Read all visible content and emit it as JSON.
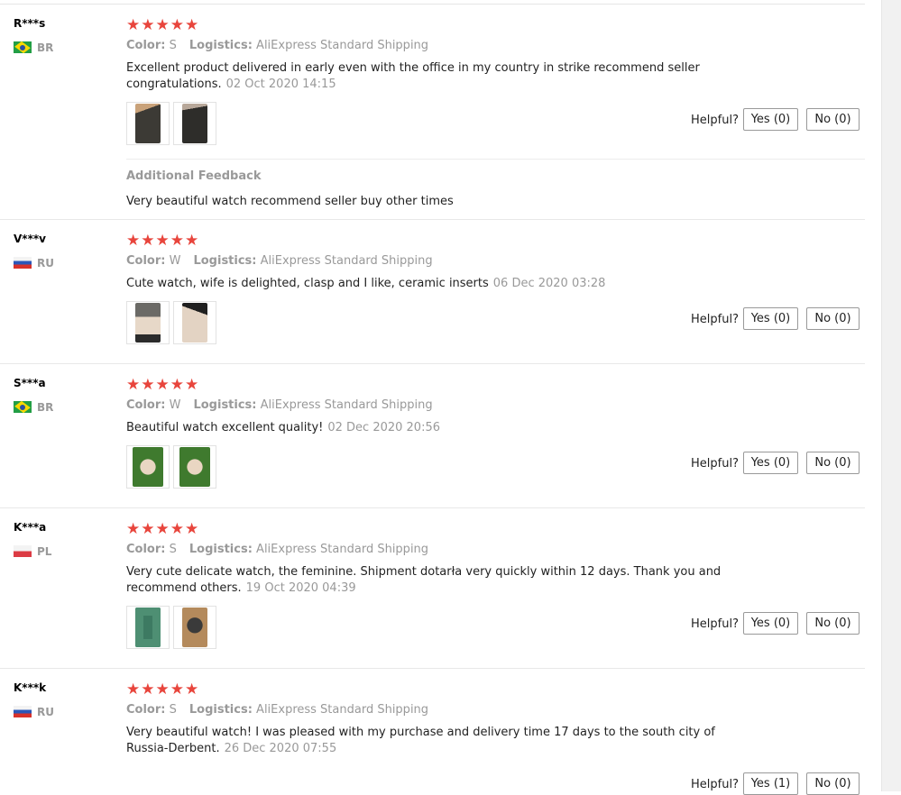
{
  "labels": {
    "color": "Color:",
    "logistics": "Logistics:",
    "helpful": "Helpful?",
    "additional_feedback": "Additional Feedback"
  },
  "rating_stars": "★★★★★",
  "reviews": [
    {
      "user": "R***s",
      "country": "BR",
      "stars": 5,
      "color": "S",
      "logistics": "AliExpress Standard Shipping",
      "text": "Excellent product delivered in early even with the office in my country in strike recommend seller congratulations.",
      "date": "02 Oct 2020 14:15",
      "yes": "Yes (0)",
      "no": "No (0)",
      "additional_feedback": "Very beautiful watch recommend seller buy other times"
    },
    {
      "user": "V***v",
      "country": "RU",
      "stars": 5,
      "color": "W",
      "logistics": "AliExpress Standard Shipping",
      "text": "Cute watch, wife is delighted, clasp and I like, ceramic inserts",
      "date": "06 Dec 2020 03:28",
      "yes": "Yes (0)",
      "no": "No (0)"
    },
    {
      "user": "S***a",
      "country": "BR",
      "stars": 5,
      "color": "W",
      "logistics": "AliExpress Standard Shipping",
      "text": "Beautiful watch excellent quality!",
      "date": "02 Dec 2020 20:56",
      "yes": "Yes (0)",
      "no": "No (0)"
    },
    {
      "user": "K***a",
      "country": "PL",
      "stars": 5,
      "color": "S",
      "logistics": "AliExpress Standard Shipping",
      "text": "Very cute delicate watch, the feminine. Shipment dotarła very quickly within 12 days. Thank you and recommend others.",
      "date": "19 Oct 2020 04:39",
      "yes": "Yes (0)",
      "no": "No (0)"
    },
    {
      "user": "K***k",
      "country": "RU",
      "stars": 5,
      "color": "S",
      "logistics": "AliExpress Standard Shipping",
      "text": "Very beautiful watch! I was pleased with my purchase and delivery time 17 days to the south city of Russia-Derbent.",
      "date": "26 Dec 2020 07:55",
      "yes": "Yes (1)",
      "no": "No (0)"
    }
  ],
  "colors": {
    "star": "#e8453c",
    "muted": "#999999"
  }
}
